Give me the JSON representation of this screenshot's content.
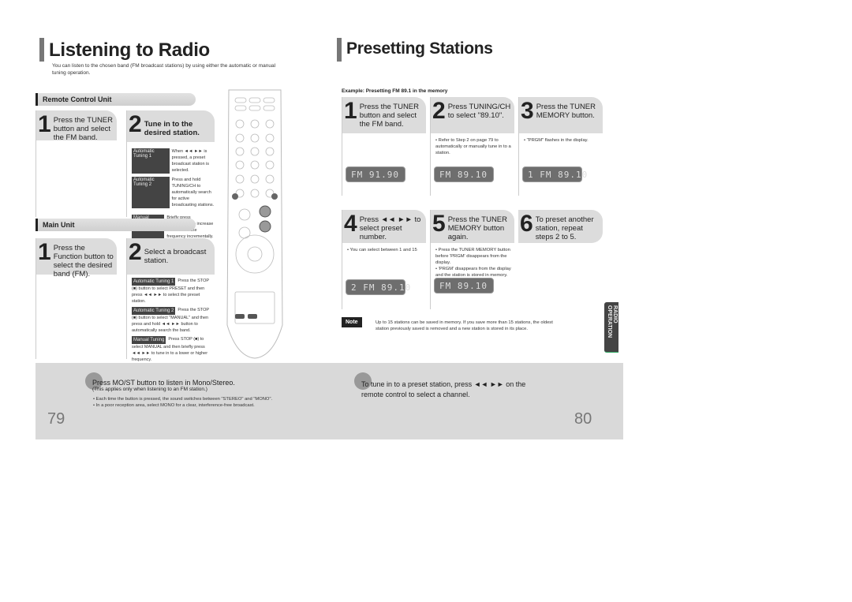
{
  "left": {
    "title": "Listening to Radio",
    "intro": "You can listen to the chosen band (FM broadcast stations) by using either the automatic or manual tuning operation.",
    "remote_section": {
      "header": "Remote Control Unit",
      "step1": {
        "num": "1",
        "text": "Press the TUNER button and select the FM band."
      },
      "step2": {
        "num": "2",
        "text": "Tune in to the desired station."
      },
      "modes": [
        {
          "tag": "Automatic Tuning 1",
          "text": "When ◄◄ ►► is pressed, a preset broadcast station is selected."
        },
        {
          "tag": "Automatic Tuning 2",
          "text": "Press and hold TUNING/CH to automatically search for active broadcasting stations."
        },
        {
          "tag": "Manual Tuning",
          "text": "Briefly press TUNING/CH to increase or decrease the frequency incrementally."
        }
      ]
    },
    "main_section": {
      "header": "Main Unit",
      "step1": {
        "num": "1",
        "text": "Press the Function button to select the desired band (FM)."
      },
      "step2": {
        "num": "2",
        "text": "Select a broadcast station."
      },
      "modes": [
        {
          "tag": "Automatic Tuning 1",
          "text": "Press the STOP (■) button to select PRESET and then press ◄◄ ►► to select the preset station."
        },
        {
          "tag": "Automatic Tuning 2",
          "text": "Press the STOP (■) button to select \"MANUAL\" and then press and hold ◄◄ ►► button to automatically search the band."
        },
        {
          "tag": "Manual Tuning",
          "text": "Press STOP (■) to select MANUAL and then briefly press ◄◄ ►► to tune in to a lower or higher frequency."
        }
      ]
    },
    "bottom": {
      "main": "Press MO/ST button to listen in Mono/Stereo.",
      "sub": "(This applies only when listening to an FM station.)",
      "bullets": [
        "Each time the button is pressed, the sound switches between \"STEREO\" and \"MONO\".",
        "In a poor reception area, select MONO for a clear, interference-free broadcast."
      ]
    },
    "page_number": "79"
  },
  "right": {
    "title": "Presetting Stations",
    "example": "Example: Presetting FM 89.1 in the memory",
    "steps": [
      {
        "num": "1",
        "text": "Press the TUNER button and select the FM band.",
        "notes": [],
        "display": "FM  91.90"
      },
      {
        "num": "2",
        "text": "Press TUNING/CH to select \"89.10\".",
        "notes": [
          "Refer to Step 2 on page 79 to automatically or manually tune in to a station."
        ],
        "display": "FM  89.10"
      },
      {
        "num": "3",
        "text": "Press the TUNER MEMORY button.",
        "notes": [
          "\"PRGM\" flashes in the display."
        ],
        "display": "1 FM  89.10"
      },
      {
        "num": "4",
        "text": "Press ◄◄ ►► to select preset number.",
        "notes": [
          "You can select between 1 and 15"
        ],
        "display": "2 FM  89.10"
      },
      {
        "num": "5",
        "text": "Press the TUNER MEMORY button again.",
        "notes": [
          "Press the TUNER MEMORY button before 'PRGM' disappears from the display.",
          "'PRGM' disappears from the display and the station is stored in memory."
        ],
        "display": "FM  89.10"
      },
      {
        "num": "6",
        "text": "To preset another station, repeat steps 2 to 5.",
        "notes": []
      }
    ],
    "note_label": "Note",
    "note_text": "Up to 15 stations can be saved in memory. If you save more than 15 stations, the oldest station previously saved is removed and a new station is stored in its place.",
    "side_tab": "RADIO OPERATION",
    "bottom": "To tune in to a preset station, press ◄◄ ►► on the remote control to select a channel.",
    "page_number": "80"
  }
}
